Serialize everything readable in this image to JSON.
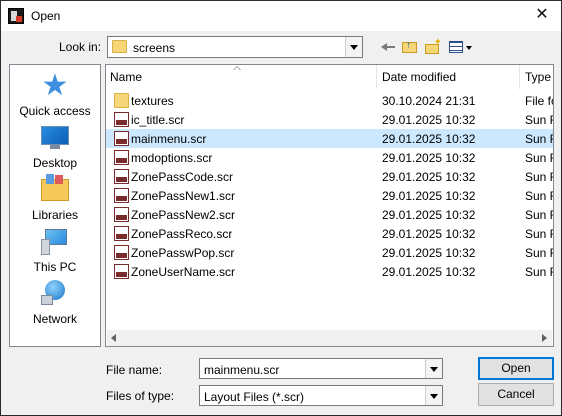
{
  "window": {
    "title": "Open",
    "close_glyph": "✕"
  },
  "toolbar": {
    "look_in_label": "Look in:",
    "look_in_value": "screens",
    "icons": [
      "back-arrow-icon",
      "up-folder-icon",
      "new-folder-icon",
      "view-menu-icon"
    ]
  },
  "places": [
    {
      "label": "Quick access",
      "icon": "quick-access-star-icon"
    },
    {
      "label": "Desktop",
      "icon": "desktop-icon"
    },
    {
      "label": "Libraries",
      "icon": "libraries-icon"
    },
    {
      "label": "This PC",
      "icon": "this-pc-icon"
    },
    {
      "label": "Network",
      "icon": "network-icon"
    }
  ],
  "file_list": {
    "columns": [
      "Name",
      "Date modified",
      "Type"
    ],
    "selected_index": 2,
    "rows": [
      {
        "name": "textures",
        "date": "30.10.2024 21:31",
        "type": "File fo",
        "kind": "folder"
      },
      {
        "name": "ic_title.scr",
        "date": "29.01.2025 10:32",
        "type": "Sun R",
        "kind": "scr"
      },
      {
        "name": "mainmenu.scr",
        "date": "29.01.2025 10:32",
        "type": "Sun R",
        "kind": "scr"
      },
      {
        "name": "modoptions.scr",
        "date": "29.01.2025 10:32",
        "type": "Sun R",
        "kind": "scr"
      },
      {
        "name": "ZonePassCode.scr",
        "date": "29.01.2025 10:32",
        "type": "Sun R",
        "kind": "scr"
      },
      {
        "name": "ZonePassNew1.scr",
        "date": "29.01.2025 10:32",
        "type": "Sun R",
        "kind": "scr"
      },
      {
        "name": "ZonePassNew2.scr",
        "date": "29.01.2025 10:32",
        "type": "Sun R",
        "kind": "scr"
      },
      {
        "name": "ZonePassReco.scr",
        "date": "29.01.2025 10:32",
        "type": "Sun R",
        "kind": "scr"
      },
      {
        "name": "ZonePasswPop.scr",
        "date": "29.01.2025 10:32",
        "type": "Sun R",
        "kind": "scr"
      },
      {
        "name": "ZoneUserName.scr",
        "date": "29.01.2025 10:32",
        "type": "Sun R",
        "kind": "scr"
      }
    ]
  },
  "footer": {
    "file_name_label": "File name:",
    "file_name_value": "mainmenu.scr",
    "file_type_label": "Files of type:",
    "file_type_value": "Layout Files (*.scr)",
    "open_label": "Open",
    "cancel_label": "Cancel"
  },
  "colors": {
    "selection": "#cce8ff",
    "default_button_border": "#0078d7"
  }
}
